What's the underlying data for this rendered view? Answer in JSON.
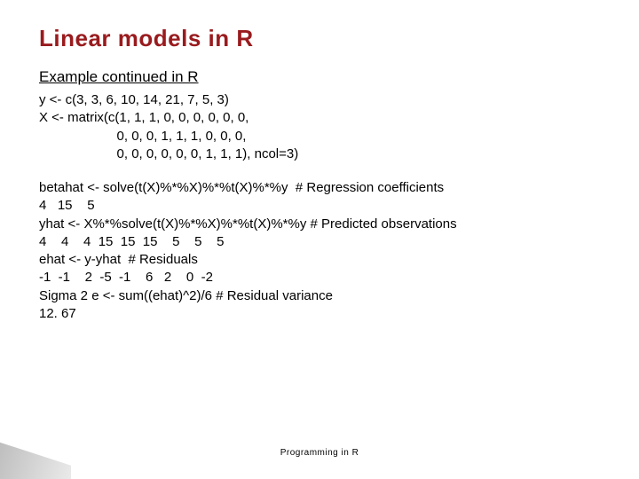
{
  "title": "Linear models in R",
  "subtitle": "Example continued in R",
  "code1": "y <- c(3, 3, 6, 10, 14, 21, 7, 5, 3)\nX <- matrix(c(1, 1, 1, 0, 0, 0, 0, 0, 0,\n                     0, 0, 0, 1, 1, 1, 0, 0, 0,\n                     0, 0, 0, 0, 0, 0, 1, 1, 1), ncol=3)",
  "code2": "betahat <- solve(t(X)%*%X)%*%t(X)%*%y  # Regression coefficients\n4   15    5\nyhat <- X%*%solve(t(X)%*%X)%*%t(X)%*%y # Predicted observations\n4    4    4  15  15  15    5    5    5\nehat <- y-yhat  # Residuals\n-1  -1    2  -5  -1    6   2    0  -2\nSigma 2 e <- sum((ehat)^2)/6 # Residual variance\n12. 67",
  "footer": "Programming in R"
}
